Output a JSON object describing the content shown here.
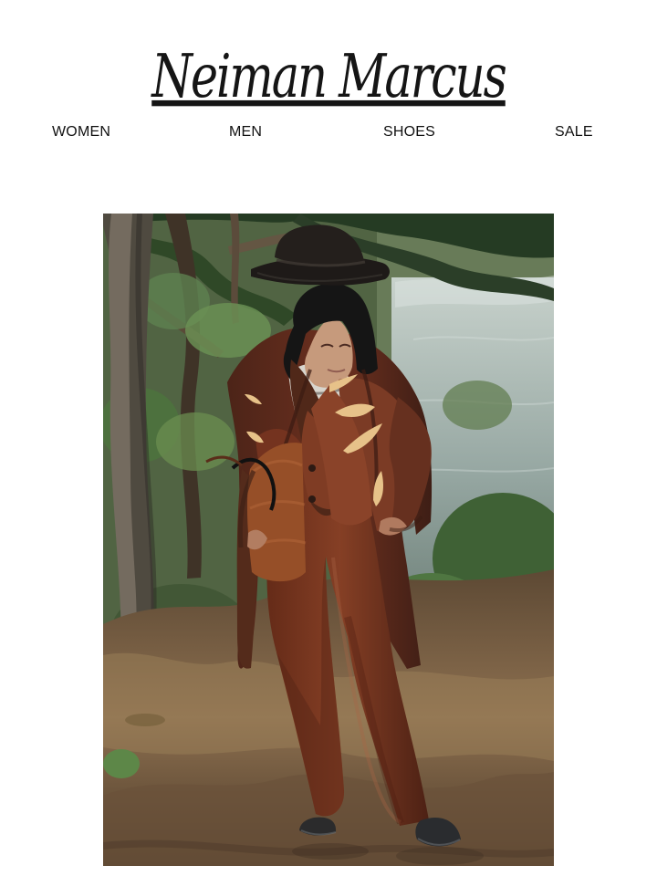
{
  "brand": {
    "name": "Neiman Marcus"
  },
  "navigation": {
    "items": [
      {
        "label": "WOMEN"
      },
      {
        "label": "MEN"
      },
      {
        "label": "SHOES"
      },
      {
        "label": "SALE"
      }
    ]
  },
  "hero": {
    "image": "editorial fashion photograph of a woman in a black hat and brown suit holding a brown handbag in a wooded lakeside setting"
  },
  "colors": {
    "background": "#ffffff",
    "text": "#111111",
    "suit": "#6a301b",
    "hat": "#1a1715",
    "foliage": "#4d6f3b",
    "water": "#aeb8b1"
  }
}
